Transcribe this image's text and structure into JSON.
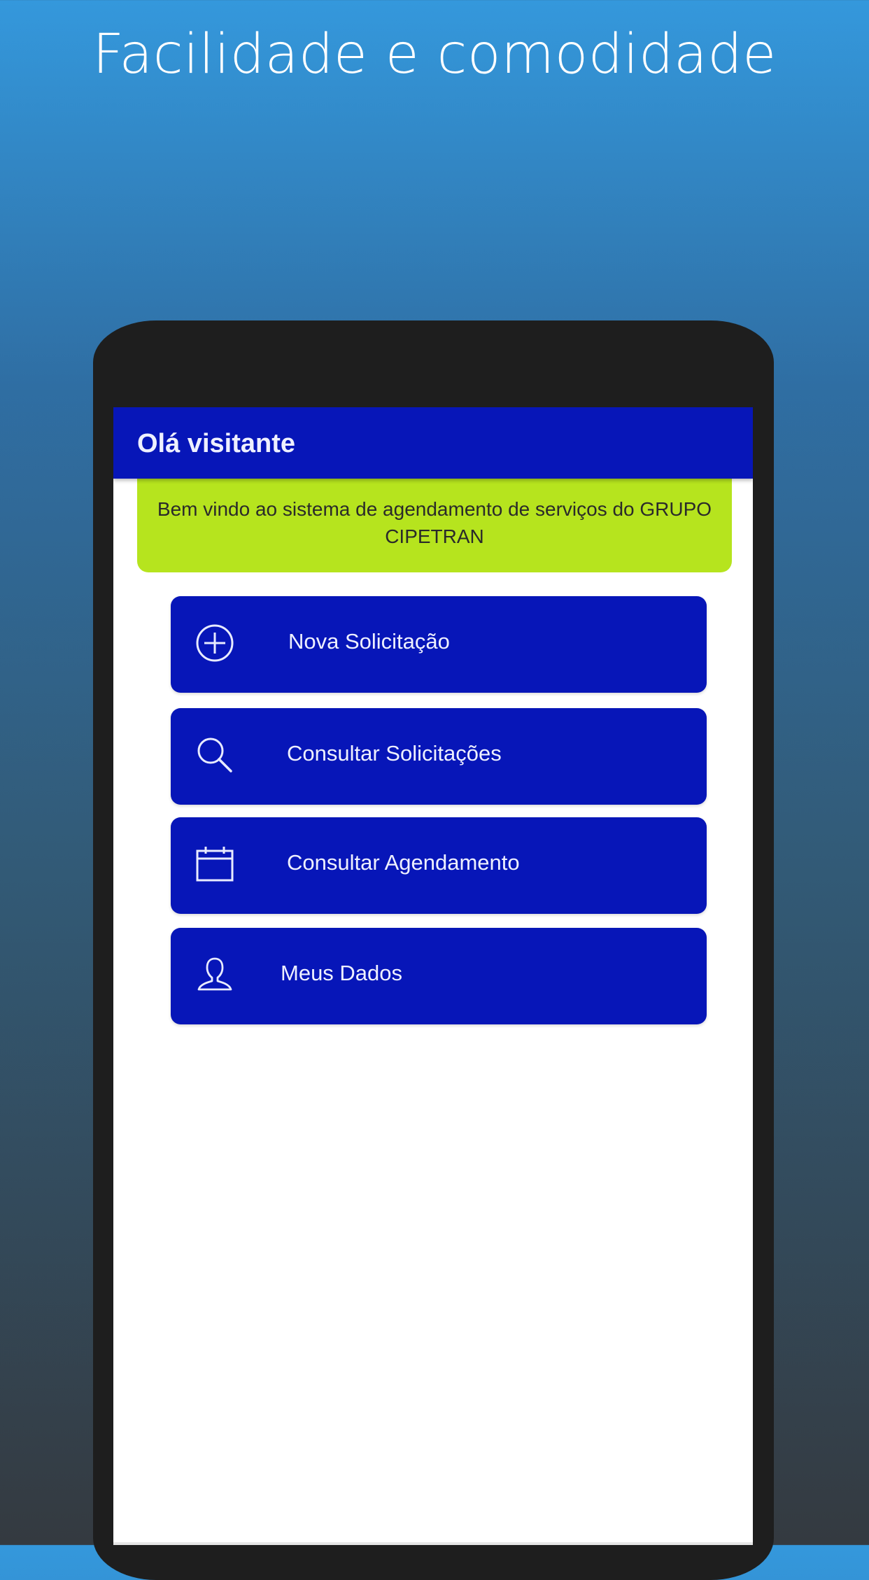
{
  "headline": "Facilidade e comodidade",
  "app": {
    "title": "Olá visitante",
    "welcome_message": "Bem vindo ao sistema de agendamento de serviços do GRUPO CIPETRAN",
    "menu": [
      {
        "label": "Nova Solicitação",
        "icon": "plus-circle-icon"
      },
      {
        "label": "Consultar Solicitações",
        "icon": "search-icon"
      },
      {
        "label": "Consultar Agendamento",
        "icon": "calendar-icon"
      },
      {
        "label": "Meus Dados",
        "icon": "user-icon"
      }
    ]
  },
  "colors": {
    "primary": "#0716b8",
    "accent": "#b6e41e",
    "background_top": "#3498dc",
    "background_bottom": "#343a40"
  }
}
